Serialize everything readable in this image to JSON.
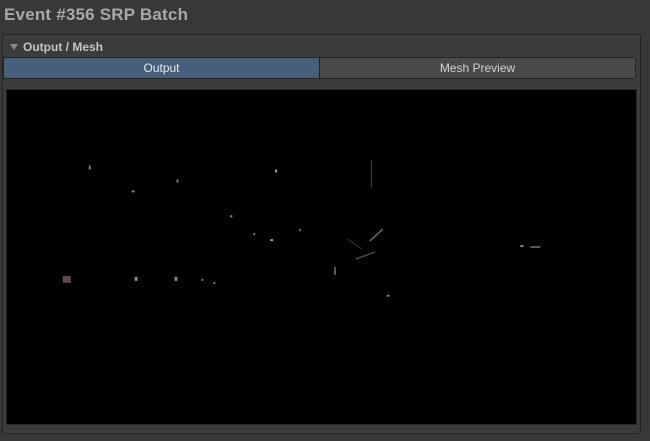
{
  "window": {
    "event_title": "Event #356 SRP Batch"
  },
  "section": {
    "title": "Output / Mesh",
    "foldout_icon": "triangle-down-icon"
  },
  "tabs": [
    {
      "label": "Output",
      "active": true
    },
    {
      "label": "Mesh Preview",
      "active": false
    }
  ],
  "colors": {
    "background": "#383838",
    "panel": "#3c3c3c",
    "active_tab": "#46607c",
    "inactive_tab": "#4a4a4a",
    "viewport": "#000000"
  }
}
